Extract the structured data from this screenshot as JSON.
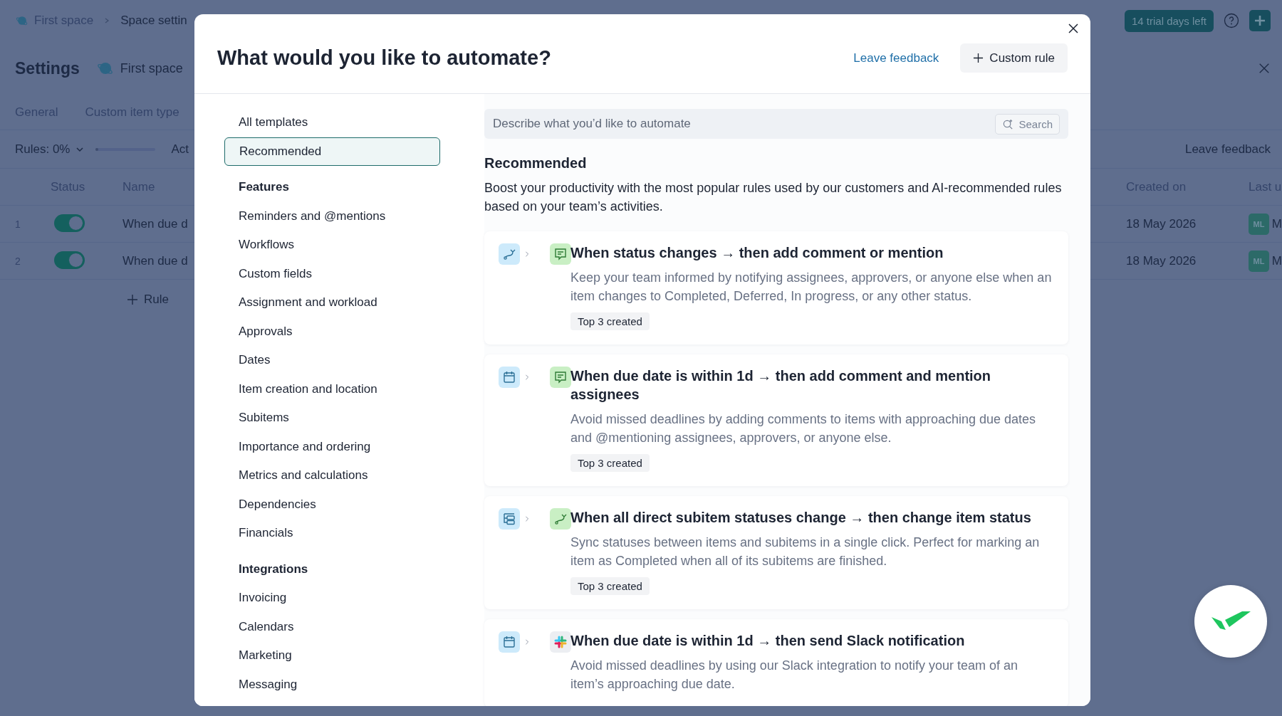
{
  "topbar": {
    "breadcrumb": [
      "First space",
      "Space settin"
    ],
    "trial_badge": "14 trial days left"
  },
  "page": {
    "title": "Settings",
    "space": "First space",
    "tabs": [
      "General",
      "Custom item type"
    ],
    "rules_filter": "Rules: 0%",
    "rules_progress": {
      "level": 0
    },
    "actions_label": "Act",
    "leave_feedback": "Leave feedback",
    "table": {
      "columns": [
        "Status",
        "Name",
        "Created on",
        "Last u"
      ],
      "rows": [
        {
          "index": "1",
          "on": true,
          "name": "When due d",
          "created": "18 May 2026",
          "avatar": "ML",
          "user": "M"
        },
        {
          "index": "2",
          "on": true,
          "name": "When due d",
          "created": "18 May 2026",
          "avatar": "ML",
          "user": "M"
        }
      ]
    },
    "add_rule": "Rule"
  },
  "modal": {
    "title": "What would you like to automate?",
    "leave_feedback": "Leave feedback",
    "custom_rule": "Custom rule",
    "nav": [
      {
        "kind": "item",
        "label": "All templates",
        "selected": false
      },
      {
        "kind": "item",
        "label": "Recommended",
        "selected": true
      },
      {
        "kind": "heading",
        "label": "Features"
      },
      {
        "kind": "item",
        "label": "Reminders and @mentions",
        "selected": false
      },
      {
        "kind": "item",
        "label": "Workflows",
        "selected": false
      },
      {
        "kind": "item",
        "label": "Custom fields",
        "selected": false
      },
      {
        "kind": "item",
        "label": "Assignment and workload",
        "selected": false
      },
      {
        "kind": "item",
        "label": "Approvals",
        "selected": false
      },
      {
        "kind": "item",
        "label": "Dates",
        "selected": false
      },
      {
        "kind": "item",
        "label": "Item creation and location",
        "selected": false
      },
      {
        "kind": "item",
        "label": "Subitems",
        "selected": false
      },
      {
        "kind": "item",
        "label": "Importance and ordering",
        "selected": false
      },
      {
        "kind": "item",
        "label": "Metrics and calculations",
        "selected": false
      },
      {
        "kind": "item",
        "label": "Dependencies",
        "selected": false
      },
      {
        "kind": "item",
        "label": "Financials",
        "selected": false
      },
      {
        "kind": "heading",
        "label": "Integrations"
      },
      {
        "kind": "item",
        "label": "Invoicing",
        "selected": false
      },
      {
        "kind": "item",
        "label": "Calendars",
        "selected": false
      },
      {
        "kind": "item",
        "label": "Marketing",
        "selected": false
      },
      {
        "kind": "item",
        "label": "Messaging",
        "selected": false
      }
    ],
    "search": {
      "placeholder": "Describe what you’d like to automate",
      "button": "Search"
    },
    "section_title": "Recommended",
    "section_description": "Boost your productivity with the most popular rules used by our customers and AI-recommended rules based on your team’s activities.",
    "templates": [
      {
        "icons": [
          {
            "kind": "status"
          },
          {
            "kind": "comment"
          }
        ],
        "title": "When status changes → then add comment or mention",
        "description": "Keep your team informed by notifying assignees, approvers, or anyone else when an item changes to Completed, Deferred, In progress, or any other status.",
        "tag": "Top 3 created"
      },
      {
        "icons": [
          {
            "kind": "date"
          },
          {
            "kind": "comment"
          }
        ],
        "title": "When due date is within 1d → then add comment and mention assignees",
        "description": "Avoid missed deadlines by adding comments to items with approaching due dates and @mentioning assignees, approvers, or anyone else.",
        "tag": "Top 3 created"
      },
      {
        "icons": [
          {
            "kind": "subitems"
          },
          {
            "kind": "status"
          }
        ],
        "title": "When all direct subitem statuses change → then change item status",
        "description": "Sync statuses between items and subitems in a single click. Perfect for marking an item as Completed when all of its subitems are finished.",
        "tag": "Top 3 created"
      },
      {
        "icons": [
          {
            "kind": "date"
          },
          {
            "kind": "slack"
          }
        ],
        "title": "When due date is within 1d → then send Slack notification",
        "description": "Avoid missed deadlines by using our Slack integration to notify your team of an item’s approaching due date."
      }
    ]
  }
}
